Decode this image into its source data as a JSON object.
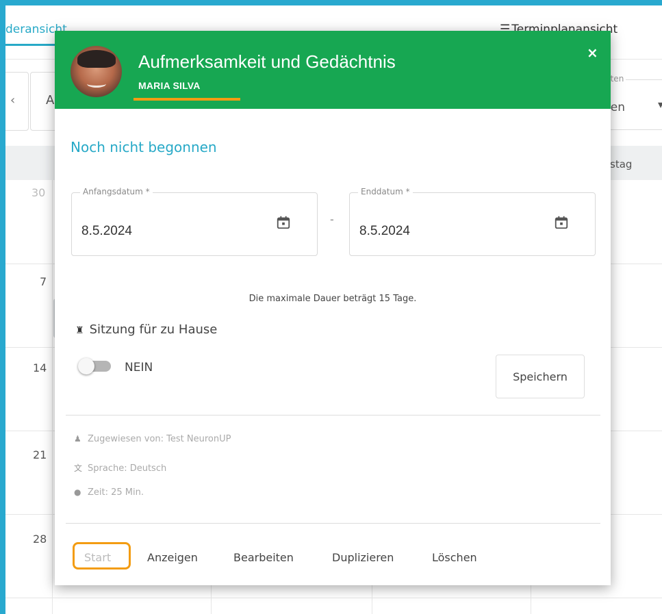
{
  "calendar": {
    "tab_left": "deransicht",
    "tab_right": "Terminplanansicht",
    "prev_button": "‹",
    "button_a": "A",
    "select_label": "nten",
    "select_value": "gen",
    "select_arrow": "▾",
    "header_day": "stag",
    "days": [
      "30",
      "7",
      "14",
      "21",
      "28"
    ]
  },
  "modal": {
    "title": "Aufmerksamkeit und Gedächtnis",
    "patient": "MARIA SILVA",
    "close_label": "×",
    "status": "Noch nicht begonnen",
    "start_date": {
      "label": "Anfangsdatum *",
      "value": "8.5.2024"
    },
    "date_separator": "-",
    "end_date": {
      "label": "Enddatum *",
      "value": "8.5.2024"
    },
    "max_duration": "Die maximale Dauer beträgt 15 Tage.",
    "home_session": {
      "label": "Sitzung für zu Hause",
      "toggle_text": "NEIN",
      "enabled": false
    },
    "save_label": "Speichern",
    "info": {
      "assigned_by": "Zugewiesen von: Test NeuronUP",
      "language": "Sprache: Deutsch",
      "time": "Zeit: 25 Min."
    },
    "actions": [
      "Start",
      "Anzeigen",
      "Bearbeiten",
      "Duplizieren",
      "Löschen"
    ]
  },
  "colors": {
    "header_green": "#17a752",
    "accent_blue": "#27a9c7",
    "highlight_orange": "#f39c12",
    "border_blue": "#29a9cf"
  },
  "icons": {
    "calendar": "calendar-icon",
    "home": "home-icon",
    "user": "user-icon",
    "language": "translate-icon",
    "time": "clock-icon",
    "close": "close-icon"
  }
}
